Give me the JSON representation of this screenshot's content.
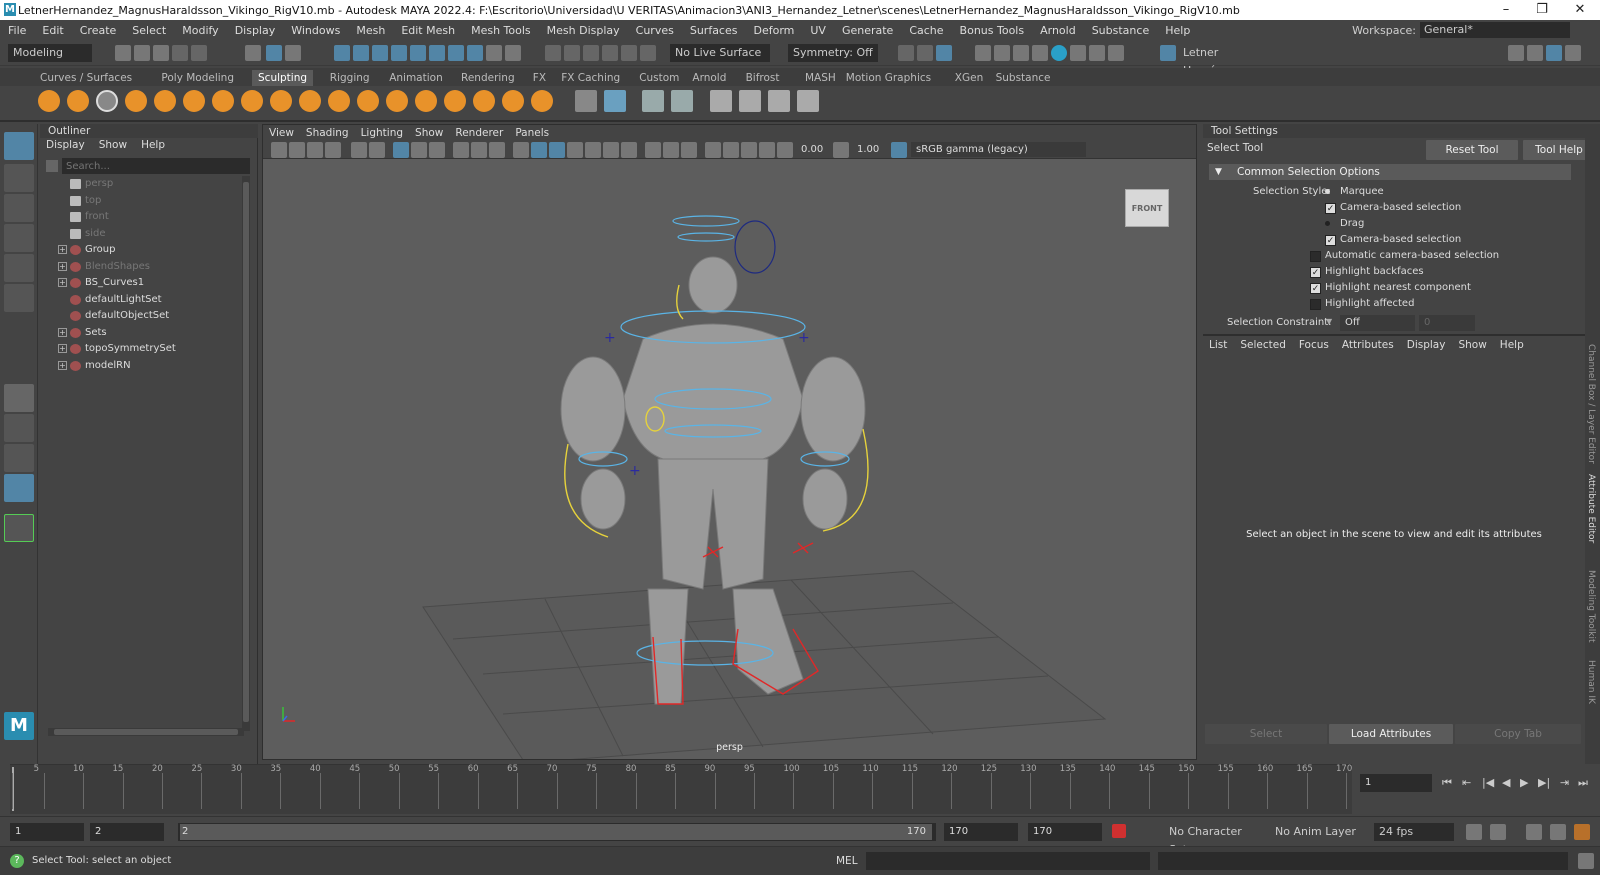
{
  "window": {
    "title": "LetnerHernandez_MagnusHaraldsson_Vikingo_RigV10.mb - Autodesk MAYA 2022.4: F:\\Escritorio\\Universidad\\U VERITAS\\Animacion3\\ANI3_Hernandez_Letner\\scenes\\LetnerHernandez_MagnusHaraldsson_Vikingo_RigV10.mb",
    "logo": "M",
    "min": "–",
    "max": "❐",
    "close": "✕"
  },
  "menubar": {
    "items": [
      "File",
      "Edit",
      "Create",
      "Select",
      "Modify",
      "Display",
      "Windows",
      "Mesh",
      "Edit Mesh",
      "Mesh Tools",
      "Mesh Display",
      "Curves",
      "Surfaces",
      "Deform",
      "UV",
      "Generate",
      "Cache",
      "Bonus Tools",
      "Arnold",
      "Substance",
      "Help"
    ],
    "workspace_label": "Workspace:",
    "workspace_value": "General*"
  },
  "statusline": {
    "mode": "Modeling",
    "live_surface": "No Live Surface",
    "symmetry": "Symmetry: Off",
    "user": "Letner Hernán..."
  },
  "shelf": {
    "tabs": [
      "Curves / Surfaces",
      "Poly Modeling",
      "Sculpting",
      "Rigging",
      "Animation",
      "Rendering",
      "FX",
      "FX Caching",
      "Custom",
      "Arnold",
      "Bifrost",
      "MASH",
      "Motion Graphics",
      "XGen",
      "Substance"
    ],
    "active_tab": "Sculpting"
  },
  "outliner": {
    "title": "Outliner",
    "menus": [
      "Display",
      "Show",
      "Help"
    ],
    "search_placeholder": "Search...",
    "items": [
      {
        "label": "persp",
        "dim": true,
        "expand": false
      },
      {
        "label": "top",
        "dim": true,
        "expand": false
      },
      {
        "label": "front",
        "dim": true,
        "expand": false
      },
      {
        "label": "side",
        "dim": true,
        "expand": false
      },
      {
        "label": "Group",
        "dim": false,
        "expand": true
      },
      {
        "label": "BlendShapes",
        "dim": true,
        "expand": true
      },
      {
        "label": "BS_Curves1",
        "dim": false,
        "expand": true
      },
      {
        "label": "defaultLightSet",
        "dim": false,
        "expand": false
      },
      {
        "label": "defaultObjectSet",
        "dim": false,
        "expand": false
      },
      {
        "label": "Sets",
        "dim": false,
        "expand": true
      },
      {
        "label": "topoSymmetrySet",
        "dim": false,
        "expand": true
      },
      {
        "label": "modelRN",
        "dim": false,
        "expand": true
      }
    ]
  },
  "viewport": {
    "menus": [
      "View",
      "Shading",
      "Lighting",
      "Show",
      "Renderer",
      "Panels"
    ],
    "exposure": "0.00",
    "gamma": "1.00",
    "colorspace": "sRGB gamma (legacy)",
    "camera": "persp",
    "viewcube": "FRONT"
  },
  "tool_settings": {
    "title": "Tool Settings",
    "tool_name": "Select Tool",
    "reset_button": "Reset Tool",
    "help_button": "Tool Help",
    "section": "Common Selection Options",
    "selection_style_label": "Selection Style:",
    "marquee": "Marquee",
    "drag": "Drag",
    "options": [
      {
        "label": "Camera-based selection",
        "checked": true
      },
      {
        "label": "Camera-based selection",
        "checked": true
      },
      {
        "label": "Automatic camera-based selection",
        "checked": false
      },
      {
        "label": "Highlight backfaces",
        "checked": true
      },
      {
        "label": "Highlight nearest component",
        "checked": true
      },
      {
        "label": "Highlight affected",
        "checked": false
      }
    ],
    "constraint_label": "Selection Constraint:",
    "constraint_value": "Off",
    "constraint_num": "0"
  },
  "attribute_editor": {
    "menus": [
      "List",
      "Selected",
      "Focus",
      "Attributes",
      "Display",
      "Show",
      "Help"
    ],
    "message": "Select an object in the scene to view and edit its attributes",
    "buttons": [
      "Select",
      "Load Attributes",
      "Copy Tab"
    ]
  },
  "side_tabs": [
    "Channel Box / Layer Editor",
    "Attribute Editor",
    "Modeling Toolkit",
    "Human IK"
  ],
  "timeline": {
    "ticks": [
      "1",
      "5",
      "10",
      "15",
      "20",
      "25",
      "30",
      "35",
      "40",
      "45",
      "50",
      "55",
      "60",
      "65",
      "70",
      "75",
      "80",
      "85",
      "90",
      "95",
      "100",
      "105",
      "110",
      "115",
      "120",
      "125",
      "130",
      "135",
      "140",
      "145",
      "150",
      "155",
      "160",
      "165",
      "170"
    ],
    "current_frame": "1"
  },
  "range": {
    "start": "1",
    "inner_start": "2",
    "slider_left": "2",
    "slider_right": "170",
    "inner_end": "170",
    "end": "170",
    "character_set": "No Character Set",
    "anim_layer": "No Anim Layer",
    "fps": "24 fps"
  },
  "command": {
    "help_text": "Select Tool: select an object",
    "lang": "MEL"
  },
  "colors": {
    "accent": "#5285a6",
    "selected_shelf": "#5a5a5a",
    "curve_blue": "#5ab4e6",
    "curve_yellow": "#e6d23c",
    "curve_red": "#e02828"
  }
}
